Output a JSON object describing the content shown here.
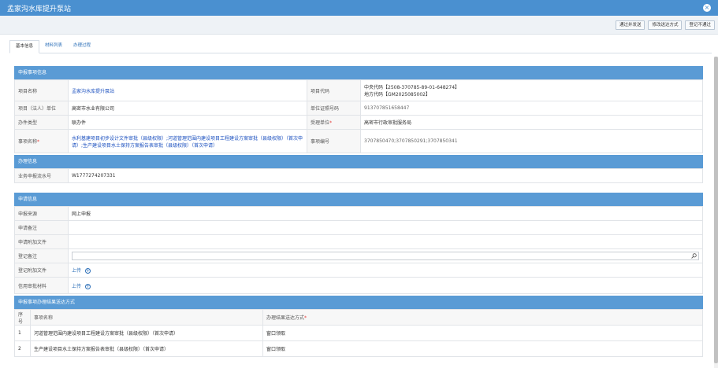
{
  "window": {
    "title": "孟家沟水库提升泵站"
  },
  "toolbar": {
    "buttons": [
      "通过并发送",
      "修改送达方式",
      "登记不通过"
    ]
  },
  "tabs": [
    "基本信息",
    "材料列表",
    "办理过程"
  ],
  "section1": {
    "title": "申报事项信息",
    "project_name_label": "项目名称",
    "project_name": "孟家沟水库提升泵站",
    "project_code_label": "项目代码",
    "central_code": "中央代码【2508-370785-89-01-648274】",
    "local_code": "地方代码【GM2025085002】",
    "legal_unit_label": "项目（法人）单位",
    "legal_unit": "高密市水业有限公司",
    "cert_label": "单位证照号码",
    "cert_no": "913707851658447",
    "handle_type_label": "办件类型",
    "handle_type": "联办件",
    "accept_unit_label": "受理单位",
    "accept_unit": "高密市行政审批服务局",
    "matter_label": "事项名称",
    "matter_name": "水利基建项目初步设计文件审批（县级权限）;河道管理范围内建设项目工程建设方案审批（县级权限）（首次申请）;生产建设项目水土保持方案报告表审批（县级权限）（首次申请）",
    "matter_no_label": "事项编号",
    "matter_no": "3707850470;3707850291;3707850341"
  },
  "section2": {
    "title": "办理信息",
    "serial_label": "业务申报流水号",
    "serial": "W1777274207331"
  },
  "section3": {
    "title": "申请信息",
    "source_label": "申报来源",
    "source": "网上申报",
    "remark_label": "申请备注",
    "attach_label": "申请附加文件",
    "reg_remark_label": "登记备注",
    "reg_attach_label": "登记附加文件",
    "credit_label": "信用审批材料",
    "upload": "上传"
  },
  "section4": {
    "title": "申报事项办理结果送达方式",
    "col_no": "序号",
    "col_name": "事项名称",
    "col_method": "办理结果送达方式",
    "rows": [
      {
        "no": "1",
        "name": "河道管理范围内建设项目工程建设方案审批（县级权限）（首次申请）",
        "method": "窗口领取"
      },
      {
        "no": "2",
        "name": "生产建设项目水土保持方案报告表审批（县级权限）（首次申请）",
        "method": "窗口领取"
      }
    ]
  }
}
